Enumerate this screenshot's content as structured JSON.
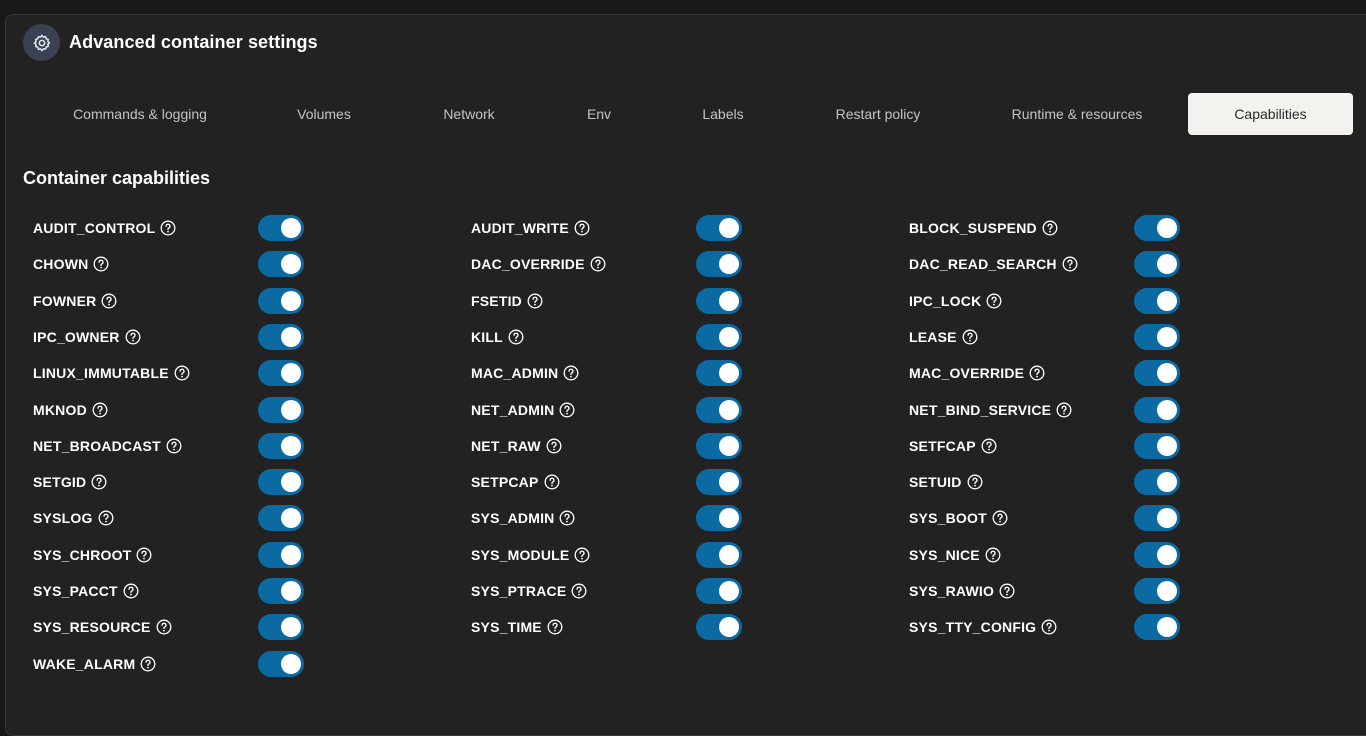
{
  "header": {
    "title": "Advanced container settings",
    "icon": "gear-icon"
  },
  "tabs": [
    {
      "label": "Commands & logging",
      "active": false
    },
    {
      "label": "Volumes",
      "active": false
    },
    {
      "label": "Network",
      "active": false
    },
    {
      "label": "Env",
      "active": false
    },
    {
      "label": "Labels",
      "active": false
    },
    {
      "label": "Restart policy",
      "active": false
    },
    {
      "label": "Runtime & resources",
      "active": false
    },
    {
      "label": "Capabilities",
      "active": true
    }
  ],
  "capabilities": {
    "title": "Container capabilities",
    "columns": [
      [
        {
          "name": "AUDIT_CONTROL",
          "enabled": true
        },
        {
          "name": "CHOWN",
          "enabled": true
        },
        {
          "name": "FOWNER",
          "enabled": true
        },
        {
          "name": "IPC_OWNER",
          "enabled": true
        },
        {
          "name": "LINUX_IMMUTABLE",
          "enabled": true
        },
        {
          "name": "MKNOD",
          "enabled": true
        },
        {
          "name": "NET_BROADCAST",
          "enabled": true
        },
        {
          "name": "SETGID",
          "enabled": true
        },
        {
          "name": "SYSLOG",
          "enabled": true
        },
        {
          "name": "SYS_CHROOT",
          "enabled": true
        },
        {
          "name": "SYS_PACCT",
          "enabled": true
        },
        {
          "name": "SYS_RESOURCE",
          "enabled": true
        },
        {
          "name": "WAKE_ALARM",
          "enabled": true
        }
      ],
      [
        {
          "name": "AUDIT_WRITE",
          "enabled": true
        },
        {
          "name": "DAC_OVERRIDE",
          "enabled": true
        },
        {
          "name": "FSETID",
          "enabled": true
        },
        {
          "name": "KILL",
          "enabled": true
        },
        {
          "name": "MAC_ADMIN",
          "enabled": true
        },
        {
          "name": "NET_ADMIN",
          "enabled": true
        },
        {
          "name": "NET_RAW",
          "enabled": true
        },
        {
          "name": "SETPCAP",
          "enabled": true
        },
        {
          "name": "SYS_ADMIN",
          "enabled": true
        },
        {
          "name": "SYS_MODULE",
          "enabled": true
        },
        {
          "name": "SYS_PTRACE",
          "enabled": true
        },
        {
          "name": "SYS_TIME",
          "enabled": true
        }
      ],
      [
        {
          "name": "BLOCK_SUSPEND",
          "enabled": true
        },
        {
          "name": "DAC_READ_SEARCH",
          "enabled": true
        },
        {
          "name": "IPC_LOCK",
          "enabled": true
        },
        {
          "name": "LEASE",
          "enabled": true
        },
        {
          "name": "MAC_OVERRIDE",
          "enabled": true
        },
        {
          "name": "NET_BIND_SERVICE",
          "enabled": true
        },
        {
          "name": "SETFCAP",
          "enabled": true
        },
        {
          "name": "SETUID",
          "enabled": true
        },
        {
          "name": "SYS_BOOT",
          "enabled": true
        },
        {
          "name": "SYS_NICE",
          "enabled": true
        },
        {
          "name": "SYS_RAWIO",
          "enabled": true
        },
        {
          "name": "SYS_TTY_CONFIG",
          "enabled": true
        }
      ]
    ]
  },
  "colors": {
    "toggle_on": "#0b6aa2",
    "active_tab_bg": "#f3f2ee",
    "panel_bg": "#222222"
  }
}
